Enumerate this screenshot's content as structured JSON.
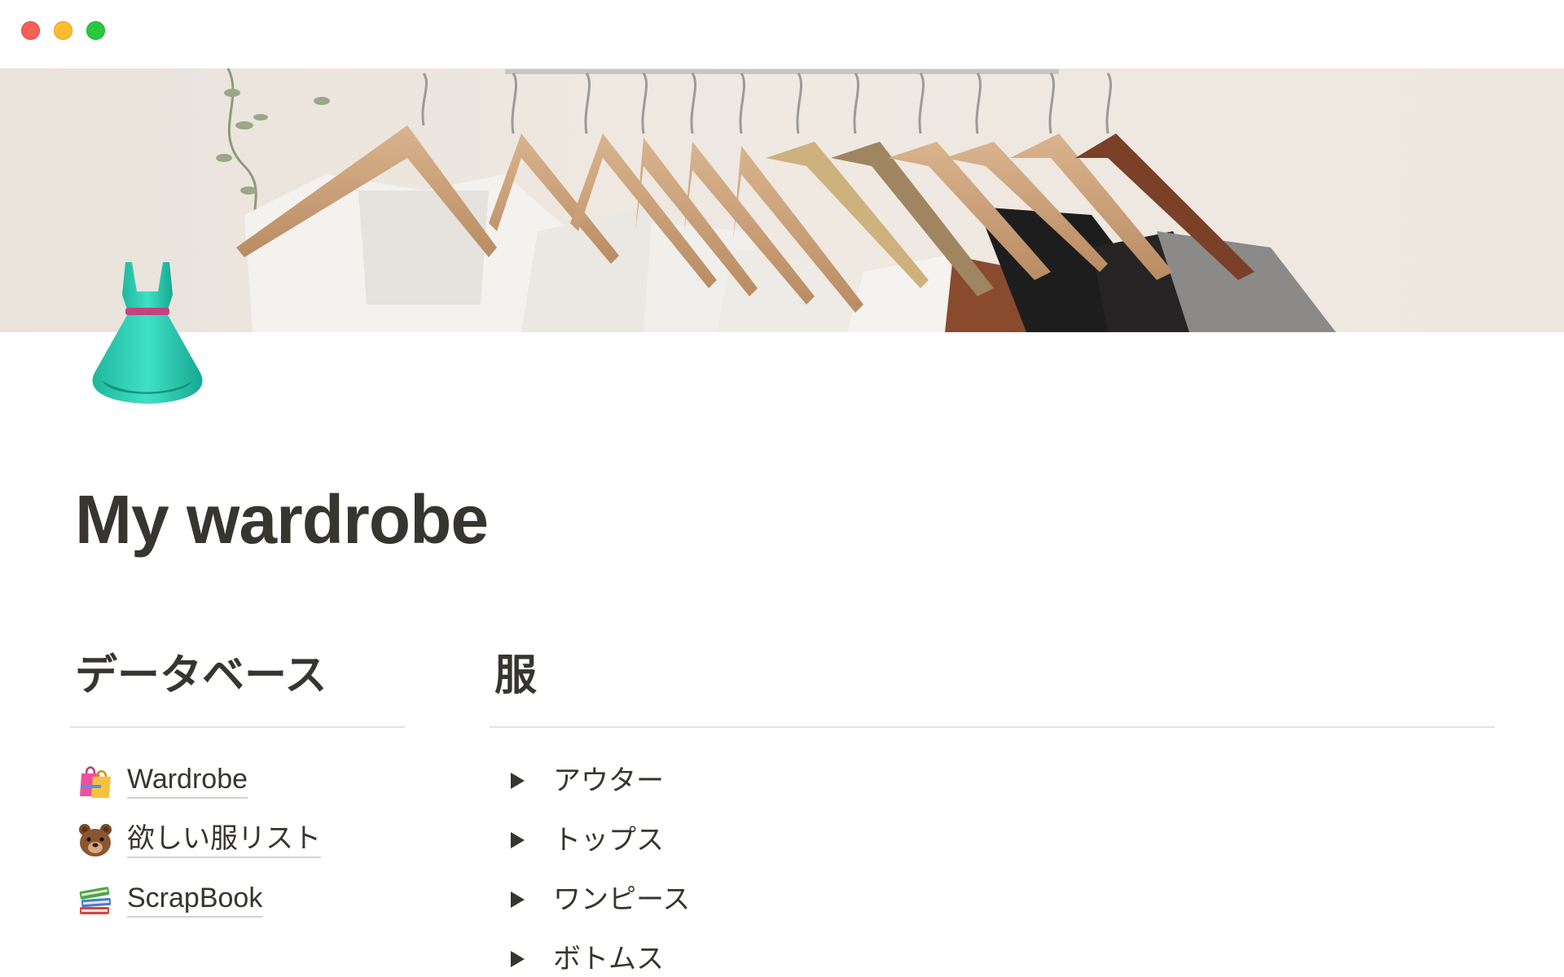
{
  "window": {
    "traffic_lights": [
      "close",
      "minimize",
      "maximize"
    ],
    "colors": {
      "close": "#ff5f57",
      "minimize": "#febc2e",
      "maximize": "#28c840"
    }
  },
  "cover": {
    "icon": "hanging-clothes-cover-image"
  },
  "page": {
    "icon": "dress-emoji",
    "title": "My wardrobe"
  },
  "databases": {
    "heading": "データベース",
    "items": [
      {
        "icon": "shopping-bags-emoji",
        "label": "Wardrobe"
      },
      {
        "icon": "bear-emoji",
        "label": "欲しい服リスト"
      },
      {
        "icon": "books-emoji",
        "label": "ScrapBook"
      }
    ]
  },
  "clothes": {
    "heading": "服",
    "toggles": [
      {
        "label": "アウター"
      },
      {
        "label": "トップス"
      },
      {
        "label": "ワンピース"
      },
      {
        "label": "ボトムス"
      }
    ]
  },
  "colors": {
    "text": "#37352f",
    "divider": "#e3e2e0",
    "dress": "#2ccfb3"
  }
}
